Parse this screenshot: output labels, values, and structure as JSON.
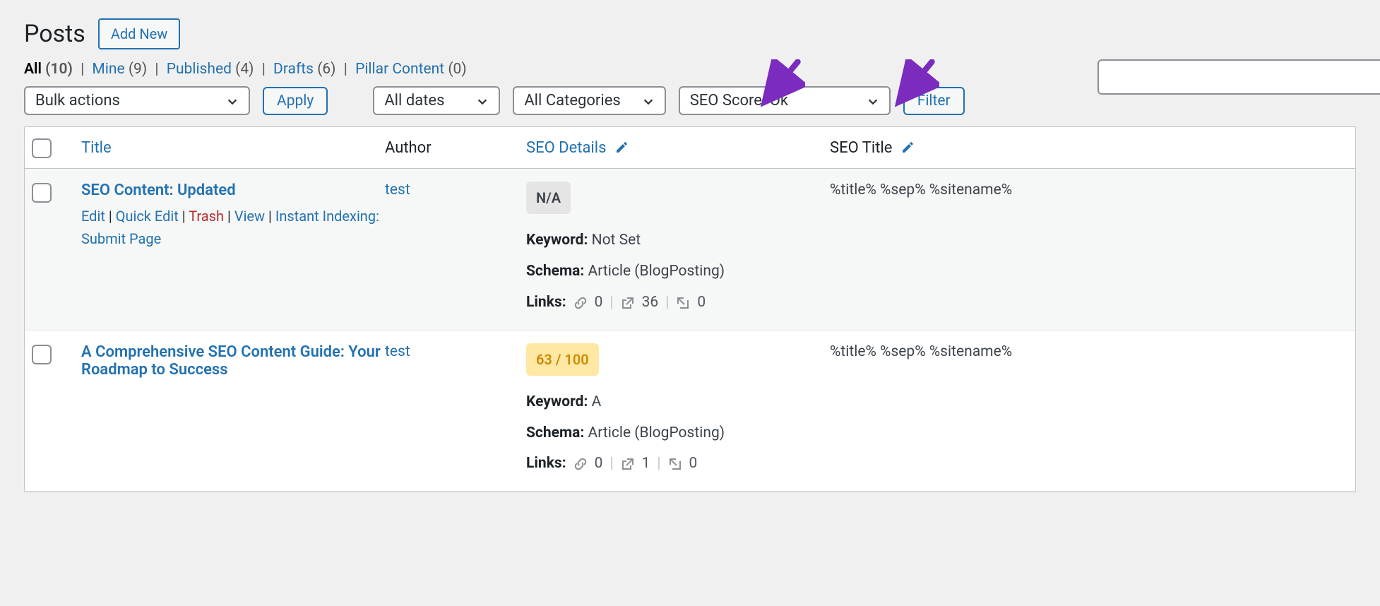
{
  "header": {
    "title": "Posts",
    "add_new": "Add New"
  },
  "views": {
    "all_label": "All",
    "all_count": "(10)",
    "mine_label": "Mine",
    "mine_count": "(9)",
    "published_label": "Published",
    "published_count": "(4)",
    "drafts_label": "Drafts",
    "drafts_count": "(6)",
    "pillar_label": "Pillar Content",
    "pillar_count": "(0)"
  },
  "filters": {
    "bulk_actions": "Bulk actions",
    "apply": "Apply",
    "all_dates": "All dates",
    "all_categories": "All Categories",
    "seo_score": "SEO Score: Ok",
    "filter": "Filter"
  },
  "columns": {
    "title": "Title",
    "author": "Author",
    "seo_details": "SEO Details",
    "seo_title": "SEO Title"
  },
  "labels": {
    "keyword": "Keyword:",
    "schema": "Schema:",
    "links": "Links:"
  },
  "rows": [
    {
      "title": "SEO Content: Updated",
      "actions": {
        "edit": "Edit",
        "quick_edit": "Quick Edit",
        "trash": "Trash",
        "view": "View",
        "instant_indexing": "Instant Indexing: Submit Page"
      },
      "author": "test",
      "score": {
        "text": "N/A",
        "class": "score-na"
      },
      "keyword": "Not Set",
      "schema": "Article (BlogPosting)",
      "links": {
        "internal": "0",
        "external": "36",
        "incoming": "0"
      },
      "seo_title": "%title% %sep% %sitename%"
    },
    {
      "title": "A Comprehensive SEO Content Guide: Your Roadmap to Success",
      "author": "test",
      "score": {
        "text": "63 / 100",
        "class": "score-ok"
      },
      "keyword": "A",
      "schema": "Article (BlogPosting)",
      "links": {
        "internal": "0",
        "external": "1",
        "incoming": "0"
      },
      "seo_title": "%title% %sep% %sitename%"
    }
  ]
}
